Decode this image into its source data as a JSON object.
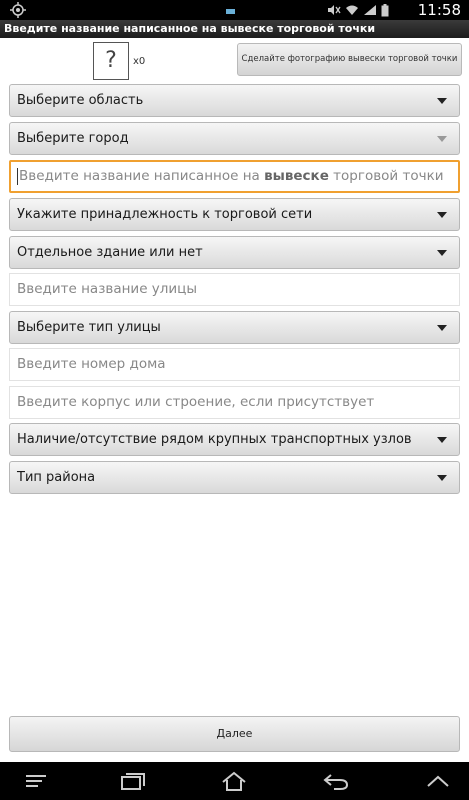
{
  "status_bar": {
    "time": "11:58"
  },
  "title_bar": {
    "title": "Введите название написанное на вывеске торговой точки"
  },
  "photo": {
    "placeholder_glyph": "?",
    "count": "x0",
    "button_label": "Сделайте фотографию вывески торговой точки"
  },
  "form": {
    "region": "Выберите область",
    "city": "Выберите город",
    "shop_name_before": "Введите название написанное на ",
    "shop_name_bold": "вывеске",
    "shop_name_after": " торговой точки",
    "chain": "Укажите принадлежность к торговой сети",
    "separate_building": "Отдельное здание или нет",
    "street_name": "Введите название улицы",
    "street_type": "Выберите тип улицы",
    "house_number": "Введите номер дома",
    "building": "Введите корпус или строение, если присутствует",
    "transport": "Наличие/отсутствие рядом крупных транспортных узлов",
    "district_type": "Тип района"
  },
  "footer": {
    "next_label": "Далее"
  }
}
